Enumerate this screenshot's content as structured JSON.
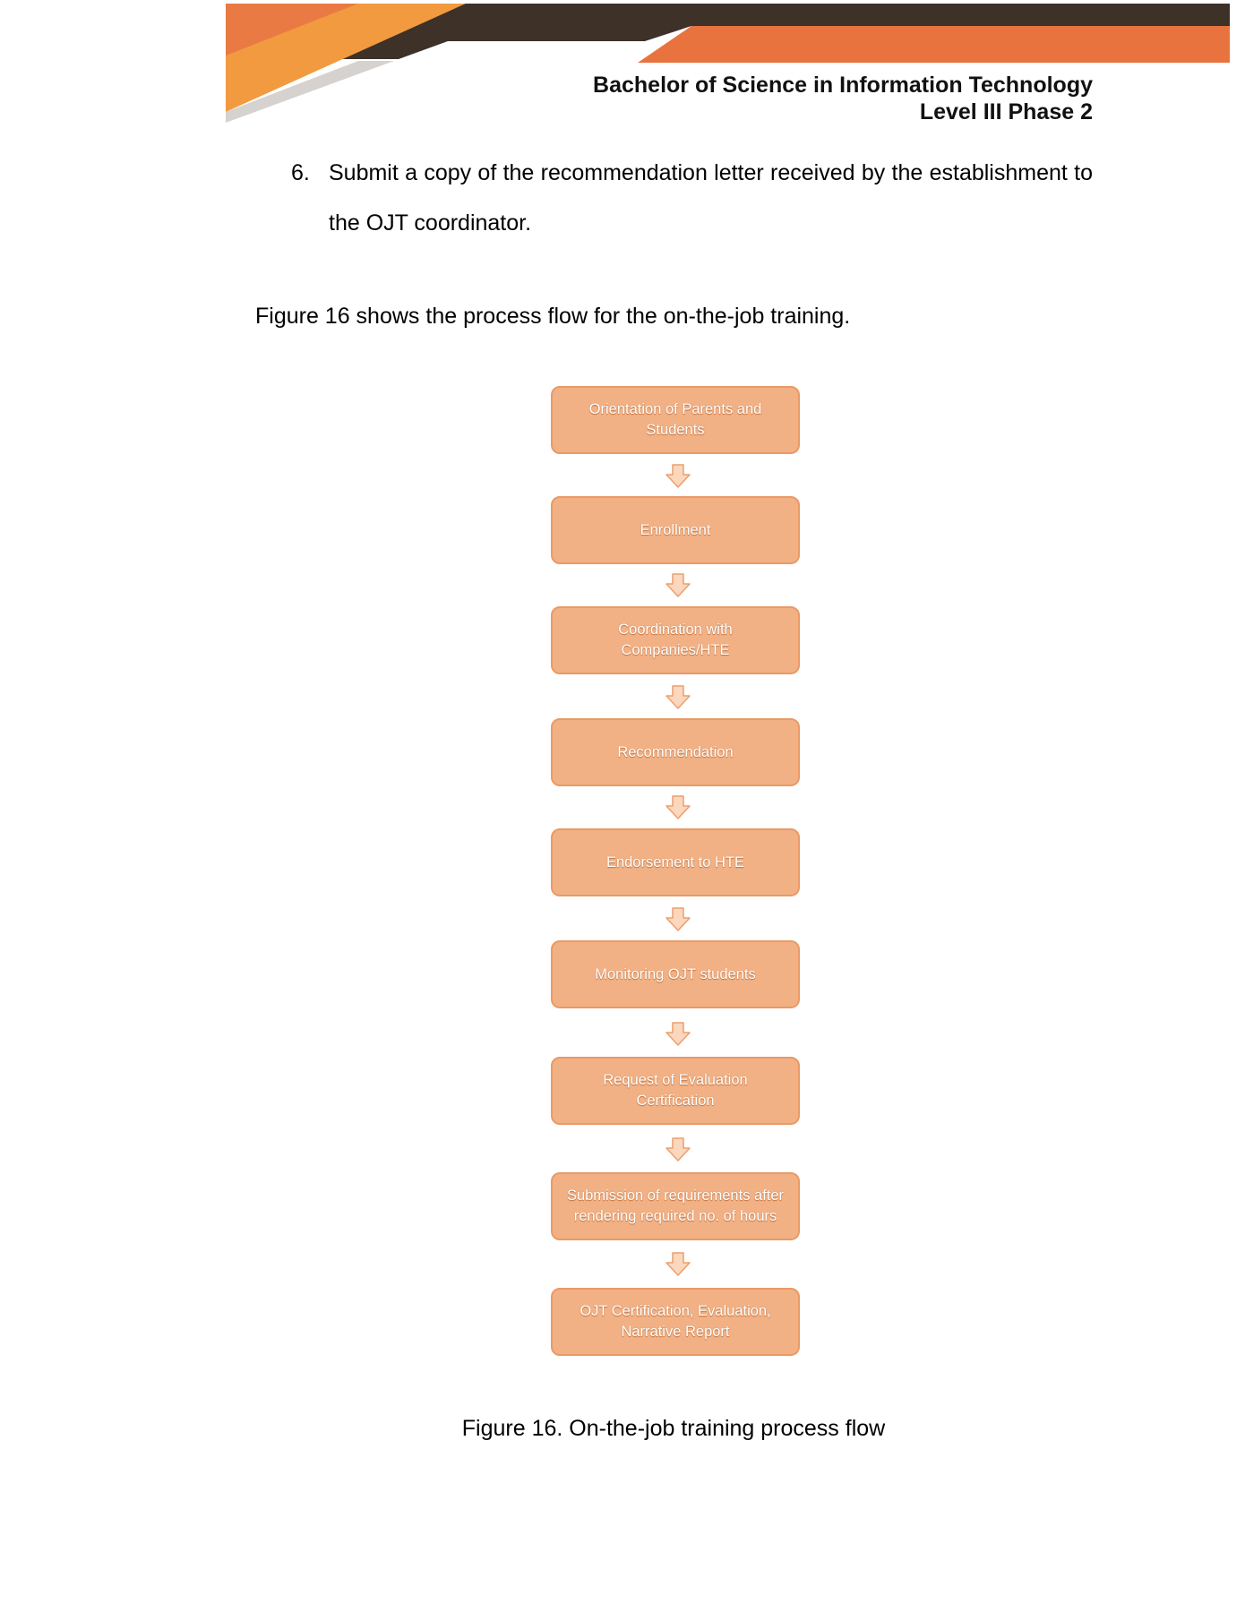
{
  "header": {
    "line1": "Bachelor of Science in Information Technology",
    "line2": "Level III Phase 2",
    "colors": {
      "dark_band": "#3d3128",
      "orange": "#e8733e",
      "light_orange": "#f29a3f",
      "grey": "#d5d2cf"
    }
  },
  "list_item": {
    "number": "6.",
    "text": "Submit a copy of the recommendation letter received by the establishment to the OJT coordinator."
  },
  "intro_paragraph": "Figure 16 shows the process flow for the on-the-job training.",
  "flow_steps": [
    "Orientation of Parents and Students",
    "Enrollment",
    "Coordination with Companies/HTE",
    "Recommendation",
    "Endorsement to HTE",
    "Monitoring OJT students",
    "Request of Evaluation Certification",
    "Submission of requirements after rendering required no. of hours",
    "OJT Certification, Evaluation, Narrative Report"
  ],
  "flow_colors": {
    "box_fill": "#f2b184",
    "box_border": "#e99a66",
    "arrow_fill": "#fbd7bd",
    "arrow_stroke": "#ec9f6c"
  },
  "caption": "Figure 16. On-the-job training process flow"
}
